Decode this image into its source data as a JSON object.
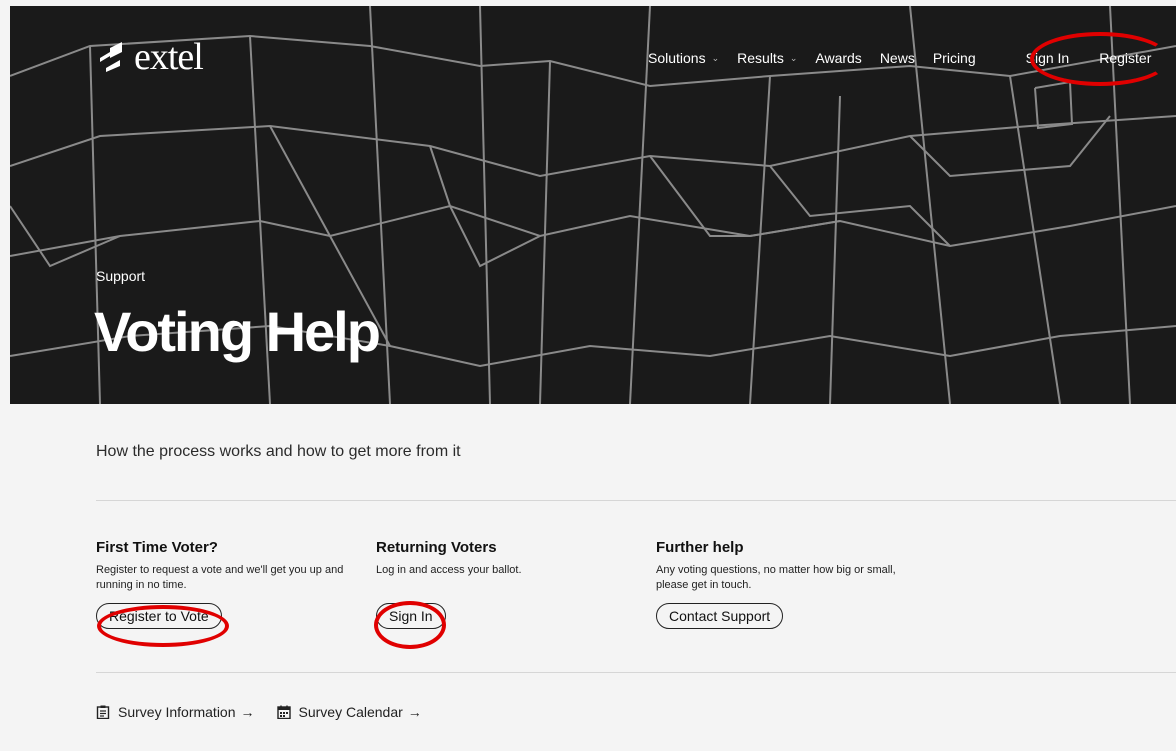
{
  "brand": {
    "name": "extel"
  },
  "nav": {
    "items": [
      {
        "label": "Solutions",
        "dropdown": true
      },
      {
        "label": "Results",
        "dropdown": true
      },
      {
        "label": "Awards",
        "dropdown": false
      },
      {
        "label": "News",
        "dropdown": false
      },
      {
        "label": "Pricing",
        "dropdown": false
      }
    ],
    "sign_in": "Sign In",
    "register": "Register"
  },
  "hero": {
    "eyebrow": "Support",
    "title": "Voting Help"
  },
  "intro": "How the process works and how to get more from it",
  "columns": [
    {
      "heading": "First Time Voter?",
      "text": "Register to request a vote and we'll get you up and running in no time.",
      "button": "Register to Vote"
    },
    {
      "heading": "Returning Voters",
      "text": "Log in and access your ballot.",
      "button": "Sign In"
    },
    {
      "heading": "Further help",
      "text": "Any voting questions, no matter how big or small, please get in touch.",
      "button": "Contact Support"
    }
  ],
  "links": [
    {
      "label": "Survey Information",
      "icon": "clipboard-icon"
    },
    {
      "label": "Survey Calendar",
      "icon": "calendar-icon"
    }
  ],
  "colors": {
    "hero_bg": "#1a1a1a",
    "annotation": "#e00000",
    "page_bg": "#f4f4f4"
  }
}
